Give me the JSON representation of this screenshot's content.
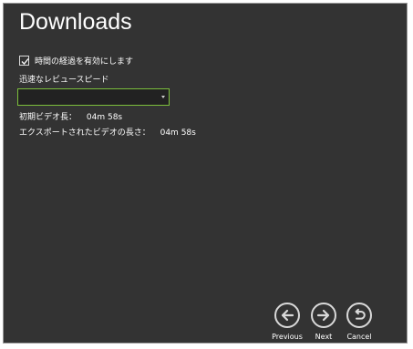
{
  "window": {
    "title": "Downloads"
  },
  "options": {
    "checkbox_label": "時間の経過を有効にします",
    "checkbox_checked": true,
    "speed_label": "迅速なレビュースピード",
    "speed_select_value": ""
  },
  "info": {
    "original_label": "初期ビデオ長：",
    "original_value": "04m  58s",
    "export_label": "エクスポートされたビデオの長さ：",
    "export_value": "04m  58s"
  },
  "nav": {
    "previous": "Previous",
    "next": "Next",
    "cancel": "Cancel"
  },
  "icons": {
    "checkbox": "checkmark-icon",
    "dropdown": "chevron-down-icon",
    "previous": "arrow-left-icon",
    "next": "arrow-right-icon",
    "cancel": "undo-icon"
  },
  "colors": {
    "background": "#333333",
    "accent_border": "#7cbf3c",
    "text": "#ffffff"
  }
}
